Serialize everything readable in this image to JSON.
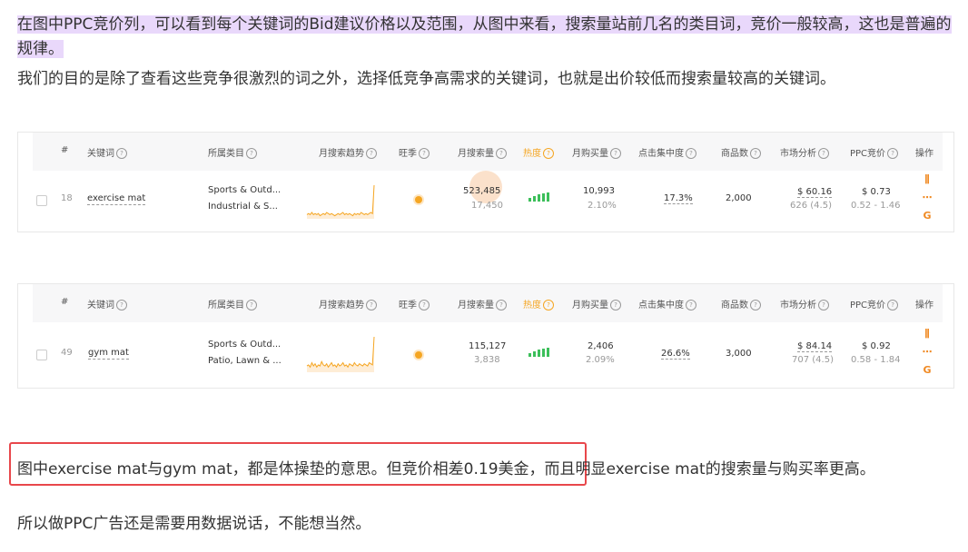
{
  "paragraphs": {
    "p1_highlighted": "在图中PPC竞价列，可以看到每个关键词的Bid建议价格以及范围，从图中来看，搜索量站前几名的类目词，竞价一般较高，这也是普遍的规律。",
    "p2": "我们的目的是除了查看这些竞争很激烈的词之外，选择低竞争高需求的关键词，也就是出价较低而搜索量较高的关键词。",
    "p3": "图中exercise mat与gym mat，都是体操垫的意思。但竞价相差0.19美金，而且明显exercise mat的搜索量与购买率更高。",
    "p4": "所以做PPC广告还是需要用数据说话，不能想当然。"
  },
  "table_headers": {
    "index": "#",
    "keyword": "关键词",
    "category": "所属类目",
    "trend": "月搜索趋势",
    "wangshou": "旺季",
    "searches": "月搜索量",
    "heat": "热度",
    "purchases": "月购买量",
    "click_concentration": "点击集中度",
    "product_count": "商品数",
    "market": "市场分析",
    "ppc": "PPC竞价",
    "actions": "操作"
  },
  "rows": [
    {
      "index": "18",
      "keyword": "exercise mat",
      "category_1": "Sports & Outd...",
      "category_2": "Industrial & S...",
      "searches": "523,485",
      "searches_sub": "17,450",
      "purchases": "10,993",
      "purchase_rate": "2.10%",
      "click_concentration": "17.3%",
      "product_count": "2,000",
      "market_price": "$ 60.16",
      "market_reviews": "626 (4.5)",
      "ppc_bid": "$ 0.73",
      "ppc_range": "0.52 - 1.46",
      "trend": [
        3,
        4,
        3,
        5,
        3,
        4,
        3,
        4,
        2,
        3,
        4,
        3,
        5,
        4,
        3,
        4,
        3,
        2,
        3,
        4,
        3,
        4,
        5,
        3,
        4,
        3,
        4,
        3,
        2,
        4,
        3,
        4,
        3,
        5,
        4,
        3,
        4,
        3,
        4,
        5,
        4,
        30
      ]
    },
    {
      "index": "49",
      "keyword": "gym mat",
      "category_1": "Sports & Outd...",
      "category_2": "Patio, Lawn & ...",
      "searches": "115,127",
      "searches_sub": "3,838",
      "purchases": "2,406",
      "purchase_rate": "2.09%",
      "click_concentration": "26.6%",
      "product_count": "3,000",
      "market_price": "$ 84.14",
      "market_reviews": "707 (4.5)",
      "ppc_bid": "$ 0.92",
      "ppc_range": "0.58 - 1.84",
      "trend": [
        5,
        6,
        4,
        8,
        5,
        7,
        4,
        6,
        5,
        9,
        6,
        5,
        7,
        4,
        6,
        8,
        5,
        6,
        4,
        7,
        5,
        6,
        8,
        5,
        6,
        4,
        7,
        6,
        5,
        8,
        6,
        5,
        7,
        6,
        5,
        7,
        6,
        5,
        8,
        7,
        6,
        32
      ]
    }
  ],
  "colors": {
    "highlight": "#e9d8fb",
    "red_box": "#e8474b",
    "accent_orange": "#f5a623",
    "heat_green": "#3cbf5a",
    "trend_line": "#f5a623"
  },
  "icons": {
    "question": "?",
    "action_chart": "bar-chart-icon",
    "action_more": "more-icon",
    "action_google": "G"
  }
}
